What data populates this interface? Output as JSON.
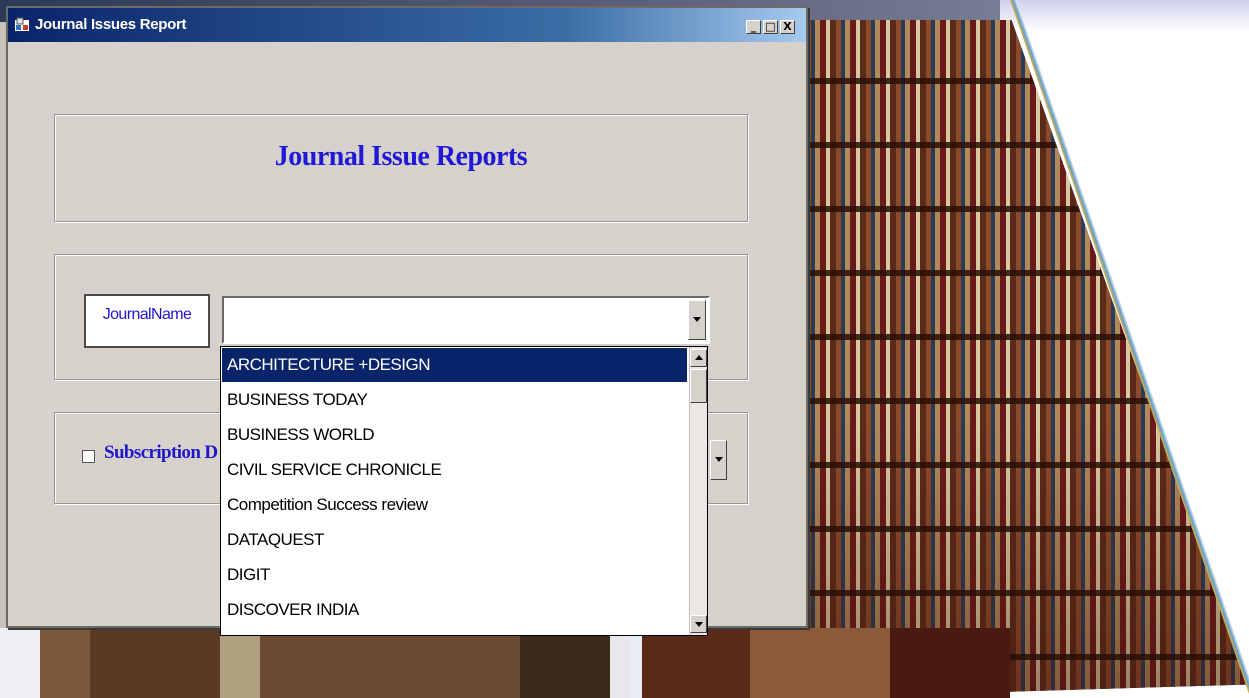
{
  "window": {
    "title": "Journal Issues Report",
    "minimize_label": "_",
    "maximize_label": "□",
    "close_label": "X"
  },
  "report": {
    "heading": "Journal Issue Reports"
  },
  "journal": {
    "label": "JournalName",
    "selected_value": "",
    "options": [
      "ARCHITECTURE +DESIGN",
      "BUSINESS TODAY",
      "BUSINESS WORLD",
      "CIVIL SERVICE CHRONICLE",
      "Competition Success review",
      "DATAQUEST",
      "DIGIT",
      "DISCOVER INDIA"
    ],
    "highlighted_option": "ARCHITECTURE +DESIGN"
  },
  "subscription": {
    "checkbox_label": "Subscription D",
    "checked": false
  },
  "colors": {
    "title_bar": "#0a246a",
    "accent_text": "#2018d8",
    "selection": "#0a246a",
    "window_face": "#d6d1cb"
  }
}
